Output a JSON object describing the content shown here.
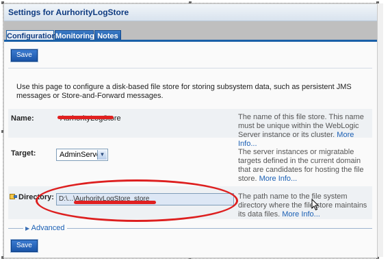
{
  "title": "Settings for AurhorityLogStore",
  "tabs": [
    {
      "label": "Configuration",
      "active": true
    },
    {
      "label": "Monitoring",
      "active": false
    },
    {
      "label": "Notes",
      "active": false
    }
  ],
  "buttons": {
    "save_top": "Save",
    "save_bottom": "Save"
  },
  "intro": "Use this page to configure a disk-based file store for storing subsystem data, such as persistent JMS messages or Store-and-Forward messages.",
  "fields": {
    "name": {
      "label": "Name:",
      "value": "AurhorityLogStore",
      "help": "The name of this file store. This name must be unique within the WebLogic Server instance or its cluster.",
      "more": "More Info..."
    },
    "target": {
      "label": "Target:",
      "value": "AdminServer",
      "help": "The server instances or migratable targets defined in the current domain that are candidates for hosting the file store.",
      "more": "More Info..."
    },
    "directory": {
      "label": "Directory:",
      "value": "D:\\...\\AurhorityLogStore_store",
      "help": "The path name to the file system directory where the file store maintains its data files.",
      "more": "More Info..."
    }
  },
  "advanced": "Advanced",
  "colors": {
    "accent": "#1960a8",
    "annotation": "#dd1f1f"
  },
  "icons": [
    "key-icon",
    "expand-triangle-icon",
    "dropdown-arrow-icon",
    "mouse-cursor-icon"
  ]
}
